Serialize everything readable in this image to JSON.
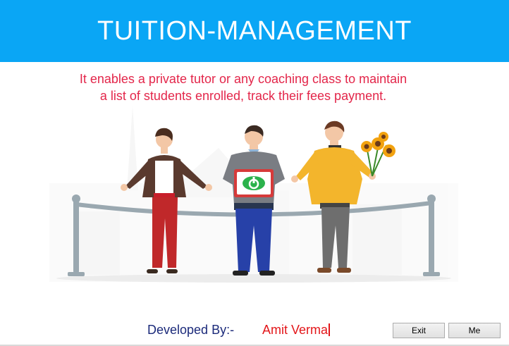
{
  "header": {
    "title": "TUITION-MANAGEMENT"
  },
  "description": "It enables a private tutor or any coaching class to maintain a list of students enrolled, track their fees payment.",
  "footer": {
    "developed_by_label": "Developed By:-",
    "developer_name": "Amit Verma"
  },
  "buttons": {
    "exit_label": "Exit",
    "me_label": "Me"
  },
  "colors": {
    "header_bg": "#0aa6f5",
    "description_text": "#e3264a",
    "developed_by_text": "#1b2a7a",
    "developer_name_text": "#e3161a"
  },
  "illustration": {
    "icons": [
      "power-logo-icon",
      "sunflower-bouquet-icon"
    ]
  }
}
